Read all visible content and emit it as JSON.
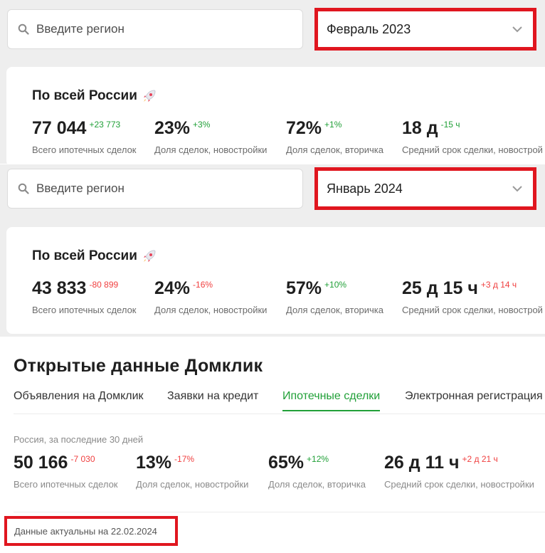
{
  "search": {
    "placeholder": "Введите регион",
    "icon": "search-icon"
  },
  "block_feb": {
    "month": "Февраль 2023",
    "title": "По всей России",
    "stats": [
      {
        "value": "77 044",
        "delta": "+23 773",
        "caption": "Всего ипотечных сделок"
      },
      {
        "value": "23%",
        "delta": "+3%",
        "caption": "Доля сделок, новостройки"
      },
      {
        "value": "72%",
        "delta": "+1%",
        "caption": "Доля сделок, вторичка"
      },
      {
        "value": "18 д",
        "delta": "-15 ч",
        "caption": "Средний срок сделки, новострой"
      }
    ]
  },
  "block_jan": {
    "month": "Январь 2024",
    "title": "По всей России",
    "stats": [
      {
        "value": "43 833",
        "delta": "-80 899",
        "caption": "Всего ипотечных сделок"
      },
      {
        "value": "24%",
        "delta": "-16%",
        "caption": "Доля сделок, новостройки"
      },
      {
        "value": "57%",
        "delta": "+10%",
        "caption": "Доля сделок, вторичка"
      },
      {
        "value": "25 д 15 ч",
        "delta": "+3 д 14 ч",
        "caption": "Средний срок сделки, новострой"
      }
    ]
  },
  "open_data": {
    "title": "Открытые данные Домклик",
    "tabs": [
      {
        "label": "Объявления на Домклик"
      },
      {
        "label": "Заявки на кредит"
      },
      {
        "label": "Ипотечные сделки"
      },
      {
        "label": "Электронная регистрация"
      }
    ],
    "period": "Россия, за последние 30 дней",
    "stats": [
      {
        "value": "50 166",
        "delta": "-7 030",
        "caption": "Всего ипотечных сделок"
      },
      {
        "value": "13%",
        "delta": "-17%",
        "caption": "Доля сделок, новостройки"
      },
      {
        "value": "65%",
        "delta": "+12%",
        "caption": "Доля сделок, вторичка"
      },
      {
        "value": "26 д 11 ч",
        "delta": "+2 д 21 ч",
        "caption": "Средний срок сделки, новостройки"
      }
    ],
    "actual": "Данные актуальны на 22.02.2024"
  },
  "colors": {
    "accent": "#21a038",
    "negative": "#f03f3f",
    "highlight": "#e0161f"
  }
}
